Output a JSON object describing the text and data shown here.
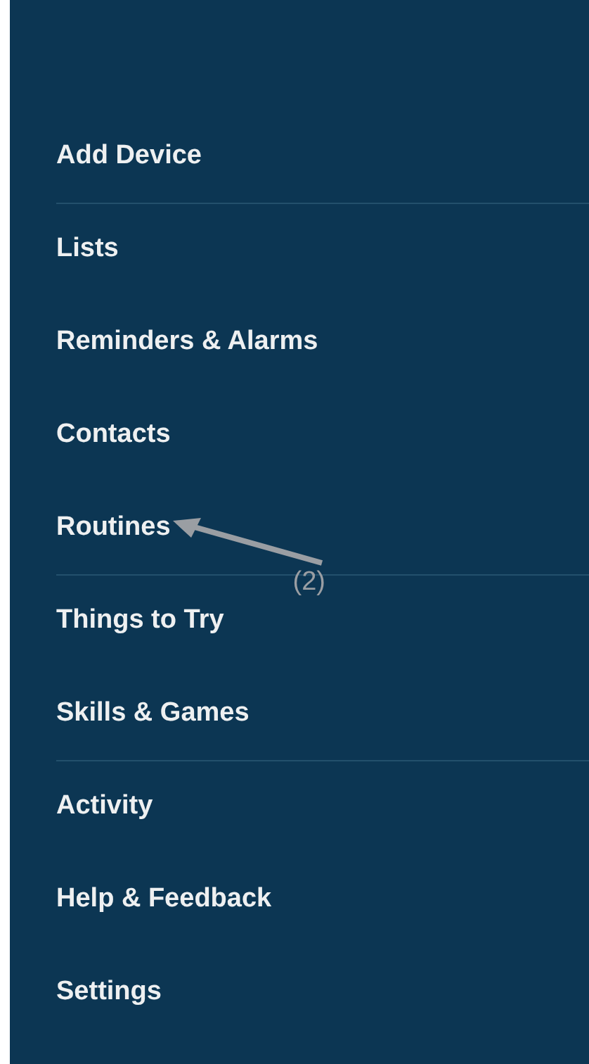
{
  "menu": {
    "items": [
      {
        "label": "Add Device",
        "divider_after": true
      },
      {
        "label": "Lists",
        "divider_after": false
      },
      {
        "label": "Reminders & Alarms",
        "divider_after": false
      },
      {
        "label": "Contacts",
        "divider_after": false
      },
      {
        "label": "Routines",
        "divider_after": true,
        "annotation": "(2)"
      },
      {
        "label": "Things to Try",
        "divider_after": false
      },
      {
        "label": "Skills & Games",
        "divider_after": true
      },
      {
        "label": "Activity",
        "divider_after": false
      },
      {
        "label": "Help & Feedback",
        "divider_after": false
      },
      {
        "label": "Settings",
        "divider_after": false
      }
    ]
  }
}
